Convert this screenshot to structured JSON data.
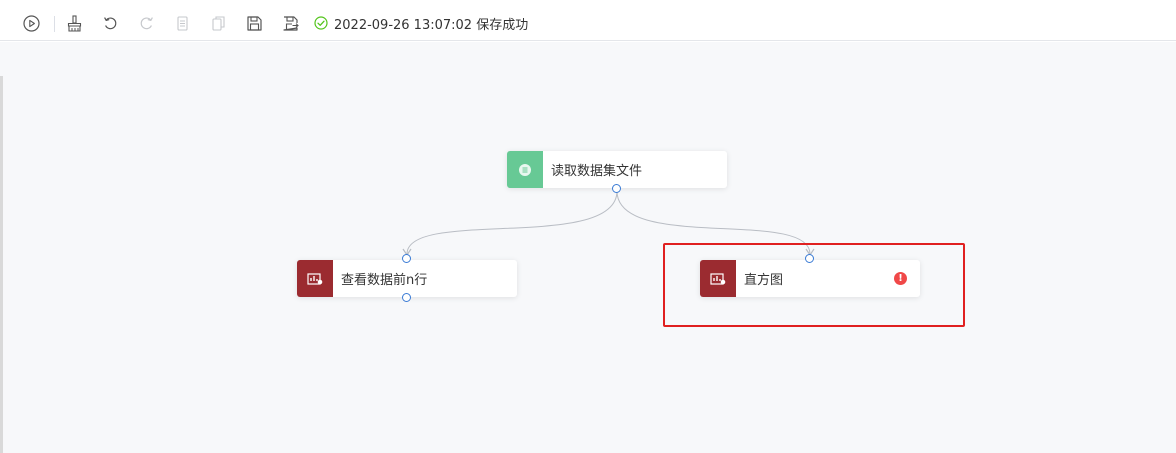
{
  "toolbar": {
    "buttons": [
      {
        "icon": "play-icon",
        "tooltip": ""
      },
      {
        "icon": "brush-icon",
        "tooltip": ""
      },
      {
        "icon": "undo-icon",
        "tooltip": ""
      },
      {
        "icon": "redo-icon",
        "tooltip": ""
      },
      {
        "icon": "copy-icon",
        "tooltip": ""
      },
      {
        "icon": "paste-icon",
        "tooltip": ""
      },
      {
        "icon": "save-icon",
        "tooltip": ""
      },
      {
        "icon": "save-as-icon",
        "tooltip": ""
      }
    ],
    "status": {
      "icon": "check-circle-icon",
      "text": "2022-09-26 13:07:02 保存成功",
      "color": "#52c41a"
    }
  },
  "canvas": {
    "nodes": [
      {
        "id": "read",
        "label": "读取数据集文件",
        "icon": "dataset-icon",
        "color": "#67c995"
      },
      {
        "id": "head",
        "label": "查看数据前n行",
        "icon": "chart-icon",
        "color": "#9b2b30"
      },
      {
        "id": "hist",
        "label": "直方图",
        "icon": "chart-icon",
        "color": "#9b2b30",
        "status": "error"
      }
    ],
    "edges": [
      {
        "from": "read",
        "to": "head"
      },
      {
        "from": "read",
        "to": "hist"
      }
    ],
    "highlight_color": "#e02020",
    "error_color": "#f04848",
    "port_color": "#3a7bd5",
    "edge_color": "#b9bdc4"
  }
}
